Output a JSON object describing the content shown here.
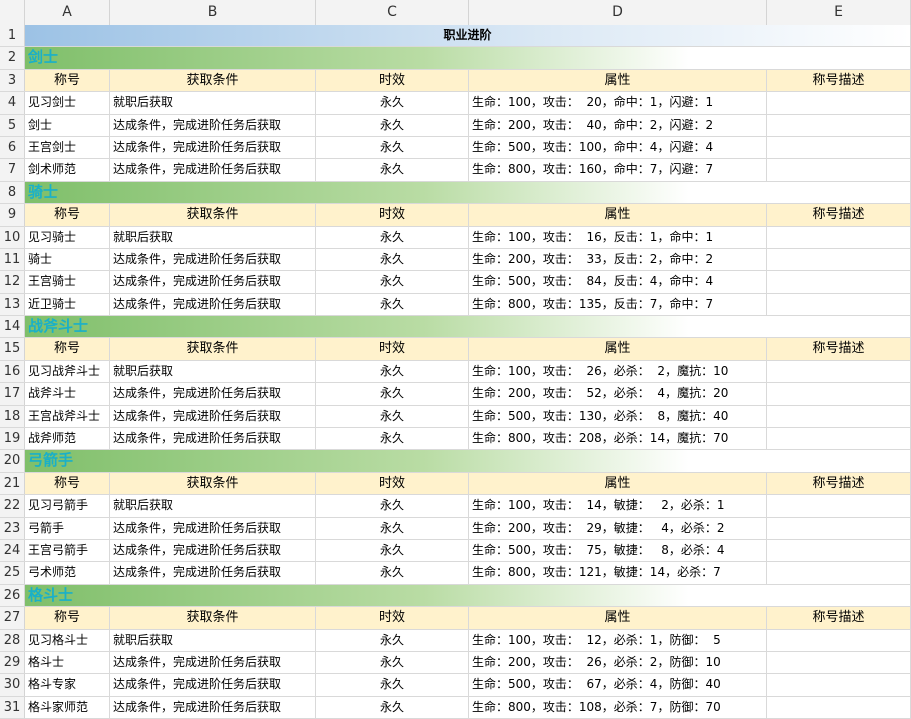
{
  "columns": [
    "A",
    "B",
    "C",
    "D",
    "E"
  ],
  "title": "职业进阶",
  "headers": {
    "name": "称号",
    "condition": "获取条件",
    "duration": "时效",
    "attr": "属性",
    "desc": "称号描述"
  },
  "classes": [
    {
      "row": 2,
      "name": "剑士",
      "header_row": 3,
      "items": [
        {
          "row": 4,
          "name": "见习剑士",
          "condition": "就职后获取",
          "duration": "永久",
          "attr": "生命：100，攻击：  20，命中：1，闪避：1",
          "desc": ""
        },
        {
          "row": 5,
          "name": "剑士",
          "condition": "达成条件，完成进阶任务后获取",
          "duration": "永久",
          "attr": "生命：200，攻击：  40，命中：2，闪避：2",
          "desc": ""
        },
        {
          "row": 6,
          "name": "王宫剑士",
          "condition": "达成条件，完成进阶任务后获取",
          "duration": "永久",
          "attr": "生命：500，攻击：100，命中：4，闪避：4",
          "desc": ""
        },
        {
          "row": 7,
          "name": "剑术师范",
          "condition": "达成条件，完成进阶任务后获取",
          "duration": "永久",
          "attr": "生命：800，攻击：160，命中：7，闪避：7",
          "desc": ""
        }
      ]
    },
    {
      "row": 8,
      "name": "骑士",
      "header_row": 9,
      "items": [
        {
          "row": 10,
          "name": "见习骑士",
          "condition": "就职后获取",
          "duration": "永久",
          "attr": "生命：100，攻击：  16，反击：1，命中：1",
          "desc": ""
        },
        {
          "row": 11,
          "name": "骑士",
          "condition": "达成条件，完成进阶任务后获取",
          "duration": "永久",
          "attr": "生命：200，攻击：  33，反击：2，命中：2",
          "desc": ""
        },
        {
          "row": 12,
          "name": "王宫骑士",
          "condition": "达成条件，完成进阶任务后获取",
          "duration": "永久",
          "attr": "生命：500，攻击：  84，反击：4，命中：4",
          "desc": ""
        },
        {
          "row": 13,
          "name": "近卫骑士",
          "condition": "达成条件，完成进阶任务后获取",
          "duration": "永久",
          "attr": "生命：800，攻击：135，反击：7，命中：7",
          "desc": ""
        }
      ]
    },
    {
      "row": 14,
      "name": "战斧斗士",
      "header_row": 15,
      "items": [
        {
          "row": 16,
          "name": "见习战斧斗士",
          "condition": "就职后获取",
          "duration": "永久",
          "attr": "生命：100，攻击：  26，必杀：  2，魔抗：10",
          "desc": ""
        },
        {
          "row": 17,
          "name": "战斧斗士",
          "condition": "达成条件，完成进阶任务后获取",
          "duration": "永久",
          "attr": "生命：200，攻击：  52，必杀：  4，魔抗：20",
          "desc": ""
        },
        {
          "row": 18,
          "name": "王宫战斧斗士",
          "condition": "达成条件，完成进阶任务后获取",
          "duration": "永久",
          "attr": "生命：500，攻击：130，必杀：  8，魔抗：40",
          "desc": ""
        },
        {
          "row": 19,
          "name": "战斧师范",
          "condition": "达成条件，完成进阶任务后获取",
          "duration": "永久",
          "attr": "生命：800，攻击：208，必杀：14，魔抗：70",
          "desc": ""
        }
      ]
    },
    {
      "row": 20,
      "name": "弓箭手",
      "header_row": 21,
      "items": [
        {
          "row": 22,
          "name": "见习弓箭手",
          "condition": "就职后获取",
          "duration": "永久",
          "attr": "生命：100，攻击：  14，敏捷：   2，必杀：1",
          "desc": ""
        },
        {
          "row": 23,
          "name": "弓箭手",
          "condition": "达成条件，完成进阶任务后获取",
          "duration": "永久",
          "attr": "生命：200，攻击：  29，敏捷：   4，必杀：2",
          "desc": ""
        },
        {
          "row": 24,
          "name": "王宫弓箭手",
          "condition": "达成条件，完成进阶任务后获取",
          "duration": "永久",
          "attr": "生命：500，攻击：  75，敏捷：   8，必杀：4",
          "desc": ""
        },
        {
          "row": 25,
          "name": "弓术师范",
          "condition": "达成条件，完成进阶任务后获取",
          "duration": "永久",
          "attr": "生命：800，攻击：121，敏捷：14，必杀：7",
          "desc": ""
        }
      ]
    },
    {
      "row": 26,
      "name": "格斗士",
      "header_row": 27,
      "items": [
        {
          "row": 28,
          "name": "见习格斗士",
          "condition": "就职后获取",
          "duration": "永久",
          "attr": "生命：100，攻击：  12，必杀：1，防御：  5",
          "desc": ""
        },
        {
          "row": 29,
          "name": "格斗士",
          "condition": "达成条件，完成进阶任务后获取",
          "duration": "永久",
          "attr": "生命：200，攻击：  26，必杀：2，防御：10",
          "desc": ""
        },
        {
          "row": 30,
          "name": "格斗专家",
          "condition": "达成条件，完成进阶任务后获取",
          "duration": "永久",
          "attr": "生命：500，攻击：  67，必杀：4，防御：40",
          "desc": ""
        },
        {
          "row": 31,
          "name": "格斗家师范",
          "condition": "达成条件，完成进阶任务后获取",
          "duration": "永久",
          "attr": "生命：800，攻击：108，必杀：7，防御：70",
          "desc": ""
        }
      ]
    }
  ],
  "colors": {
    "title_bg": "#9cc2e5",
    "class_bg": "#7fbf6a",
    "class_text": "#1ab0c8",
    "header_bg": "#fff2cc"
  }
}
